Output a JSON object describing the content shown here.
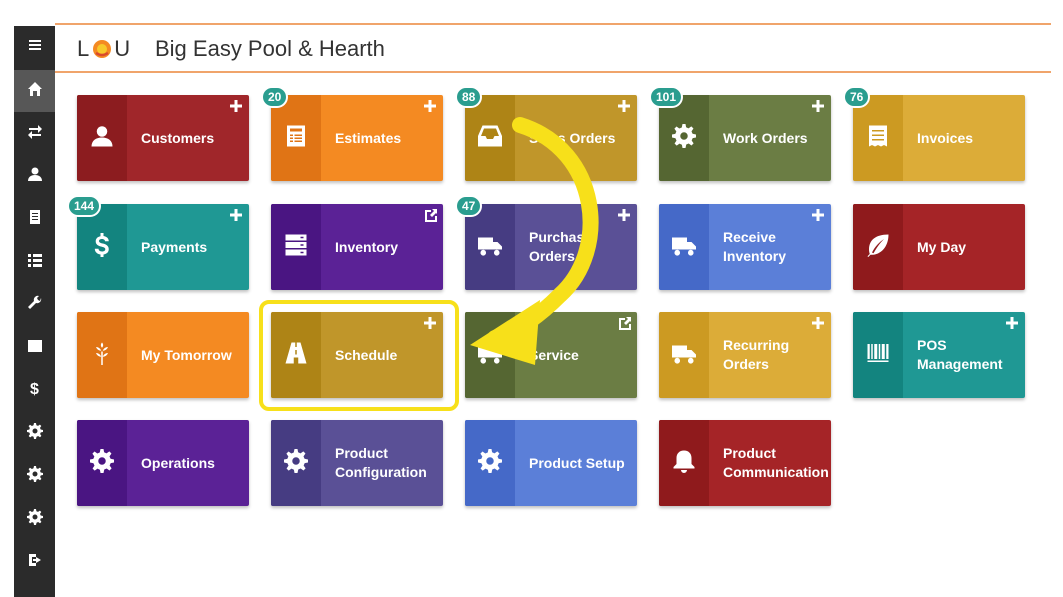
{
  "app": {
    "logo_left": "L",
    "logo_right": "U",
    "company": "Big Easy Pool & Hearth"
  },
  "sidebar": {
    "items": [
      {
        "name": "menu-icon"
      },
      {
        "name": "home-icon",
        "active": true
      },
      {
        "name": "transfer-icon"
      },
      {
        "name": "user-icon"
      },
      {
        "name": "document-icon"
      },
      {
        "name": "list-icon"
      },
      {
        "name": "wrench-icon"
      },
      {
        "name": "calendar-icon"
      },
      {
        "name": "dollar-icon",
        "text": "$"
      },
      {
        "name": "gear-icon"
      },
      {
        "name": "gear-icon"
      },
      {
        "name": "gear-icon"
      },
      {
        "name": "logout-icon"
      }
    ]
  },
  "colors": {
    "badge": "#2a9d8f",
    "highlight": "#f7e01a",
    "arrow": "#f7e01a",
    "header_accent": "#f0a46b"
  },
  "tiles": [
    {
      "label": "Customers",
      "icon": "user-icon",
      "corner": "plus",
      "bg": "#a0262a",
      "left_bg": "#8c1c1f"
    },
    {
      "label": "Estimates",
      "icon": "document-list-icon",
      "corner": "plus",
      "badge": "20",
      "bg": "#f48a22",
      "left_bg": "#e07415"
    },
    {
      "label": "Sales Orders",
      "icon": "inbox-icon",
      "corner": "plus",
      "badge": "88",
      "bg": "#c0962a",
      "left_bg": "#ae8416"
    },
    {
      "label": "Work Orders",
      "icon": "gear-icon",
      "corner": "plus",
      "badge": "101",
      "bg": "#6b7d44",
      "left_bg": "#556632"
    },
    {
      "label": "Invoices",
      "icon": "receipt-icon",
      "corner": "none",
      "badge": "76",
      "bg": "#dcac38",
      "left_bg": "#cc9a22"
    },
    {
      "label": "Payments",
      "icon": "dollar-icon",
      "corner": "plus",
      "badge": "144",
      "bg": "#1f9894",
      "left_bg": "#13847f"
    },
    {
      "label": "Inventory",
      "icon": "server-icon",
      "corner": "external",
      "bg": "#5b2296",
      "left_bg": "#4a1582"
    },
    {
      "label": "Purchase\nOrders",
      "icon": "truck-icon",
      "corner": "plus",
      "badge": "47",
      "bg": "#5a5096",
      "left_bg": "#463c82"
    },
    {
      "label": "Receive\nInventory",
      "icon": "truck-icon",
      "corner": "plus",
      "bg": "#5b7fd8",
      "left_bg": "#4569c8"
    },
    {
      "label": "My Day",
      "icon": "leaf-icon",
      "corner": "none",
      "bg": "#a52427",
      "left_bg": "#8f1a1c"
    },
    {
      "label": "My Tomorrow",
      "icon": "wheat-icon",
      "corner": "none",
      "bg": "#f48a22",
      "left_bg": "#e07415"
    },
    {
      "label": "Schedule",
      "icon": "road-icon",
      "corner": "plus",
      "bg": "#c0962a",
      "left_bg": "#ae8416"
    },
    {
      "label": "Service",
      "icon": "truck-icon",
      "corner": "external",
      "bg": "#6b7d44",
      "left_bg": "#556632"
    },
    {
      "label": "Recurring\nOrders",
      "icon": "truck-icon",
      "corner": "plus",
      "bg": "#dcac38",
      "left_bg": "#cc9a22"
    },
    {
      "label": "POS\nManagement",
      "icon": "barcode-icon",
      "corner": "plus",
      "bg": "#1f9894",
      "left_bg": "#13847f"
    },
    {
      "label": "Operations",
      "icon": "gear-icon",
      "corner": "none",
      "bg": "#5b2296",
      "left_bg": "#4a1582"
    },
    {
      "label": "Product\nConfiguration",
      "icon": "gear-icon",
      "corner": "none",
      "bg": "#5a5096",
      "left_bg": "#463c82"
    },
    {
      "label": "Product Setup",
      "icon": "gear-icon",
      "corner": "none",
      "bg": "#5b7fd8",
      "left_bg": "#4569c8"
    },
    {
      "label": "Product\nCommunication",
      "icon": "bell-icon",
      "corner": "none",
      "bg": "#a52427",
      "left_bg": "#8f1a1c"
    }
  ]
}
